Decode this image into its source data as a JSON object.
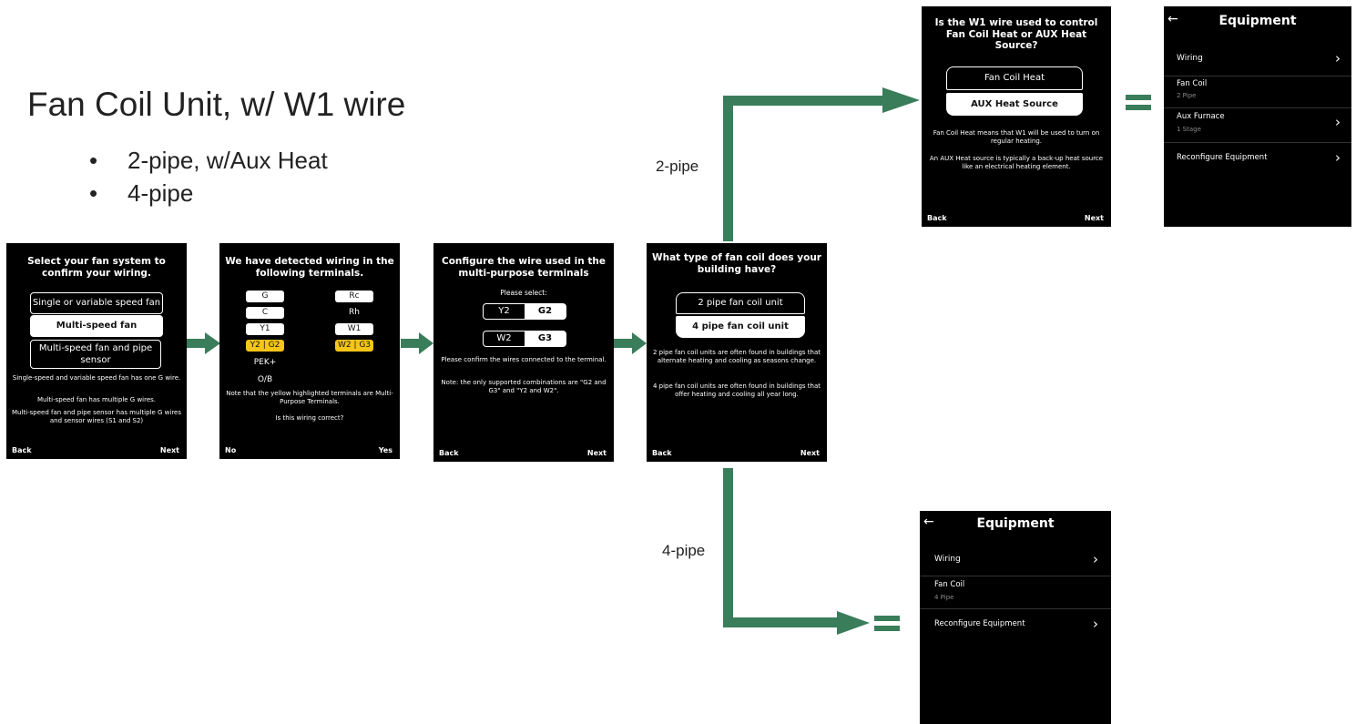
{
  "heading": "Fan Coil Unit, w/ W1 wire",
  "bullets": [
    "2-pipe, w/Aux Heat",
    "4-pipe"
  ],
  "branch_labels": {
    "two_pipe": "2-pipe",
    "four_pipe": "4-pipe"
  },
  "colors": {
    "arrow": "#3a7d5a",
    "highlight": "#f5c518",
    "screen_bg": "#000000"
  },
  "screen1": {
    "title": "Select your fan system to confirm your wiring.",
    "options": [
      "Single or variable speed fan",
      "Multi-speed fan",
      "Multi-speed fan and pipe sensor"
    ],
    "notes": [
      "Single-speed and variable speed fan has one G wire.",
      "Multi-speed fan has multiple G wires.",
      "Multi-speed fan and pipe sensor has multiple G wires and sensor wires (S1 and S2)"
    ],
    "back": "Back",
    "next": "Next"
  },
  "screen2": {
    "title": "We have detected wiring in the following terminals.",
    "left_terminals": [
      "G",
      "C",
      "Y1",
      "Y2 | G2",
      "PEK+",
      "O/B"
    ],
    "right_terminals": [
      "Rc",
      "Rh",
      "W1",
      "W2 | G3"
    ],
    "note1": "Note that the yellow highlighted terminals are Multi-Purpose Terminals.",
    "note2": "Is this wiring correct?",
    "no": "No",
    "yes": "Yes"
  },
  "screen3": {
    "title": "Configure the wire used in the multi-purpose terminals",
    "prompt": "Please select:",
    "seg1": [
      "Y2",
      "G2"
    ],
    "seg2": [
      "W2",
      "G3"
    ],
    "note1": "Please confirm the wires connected to the terminal.",
    "note2": "Note: the only supported combinations are \"G2 and G3\" and \"Y2 and W2\".",
    "back": "Back",
    "next": "Next"
  },
  "screen4": {
    "title": "What type of fan coil does your building have?",
    "options": [
      "2 pipe fan coil unit",
      "4 pipe fan coil unit"
    ],
    "note1": "2 pipe fan coil units are often found in buildings that alternate heating and cooling as seasons change.",
    "note2": "4 pipe fan coil units are often found in buildings that offer heating and cooling all year long.",
    "back": "Back",
    "next": "Next"
  },
  "screen5": {
    "title": "Is the W1 wire used to control Fan Coil Heat or AUX Heat Source?",
    "options": [
      "Fan Coil Heat",
      "AUX Heat Source"
    ],
    "note1": "Fan Coil Heat means that W1 will be used to turn on regular heating.",
    "note2": "An AUX Heat source is typically a back-up heat source like an electrical heating element.",
    "back": "Back",
    "next": "Next"
  },
  "equip_top": {
    "title": "Equipment",
    "back_icon": "back-arrow-icon",
    "rows": [
      {
        "label": "Wiring",
        "sub": "",
        "chevron": true
      },
      {
        "label": "Fan Coil",
        "sub": "2 Pipe",
        "chevron": false
      },
      {
        "label": "Aux Furnace",
        "sub": "1 Stage",
        "chevron": true
      },
      {
        "label": "Reconfigure Equipment",
        "sub": "",
        "chevron": true
      }
    ]
  },
  "equip_bottom": {
    "title": "Equipment",
    "back_icon": "back-arrow-icon",
    "rows": [
      {
        "label": "Wiring",
        "sub": "",
        "chevron": true
      },
      {
        "label": "Fan Coil",
        "sub": "4 Pipe",
        "chevron": false
      },
      {
        "label": "Reconfigure Equipment",
        "sub": "",
        "chevron": true
      }
    ]
  }
}
